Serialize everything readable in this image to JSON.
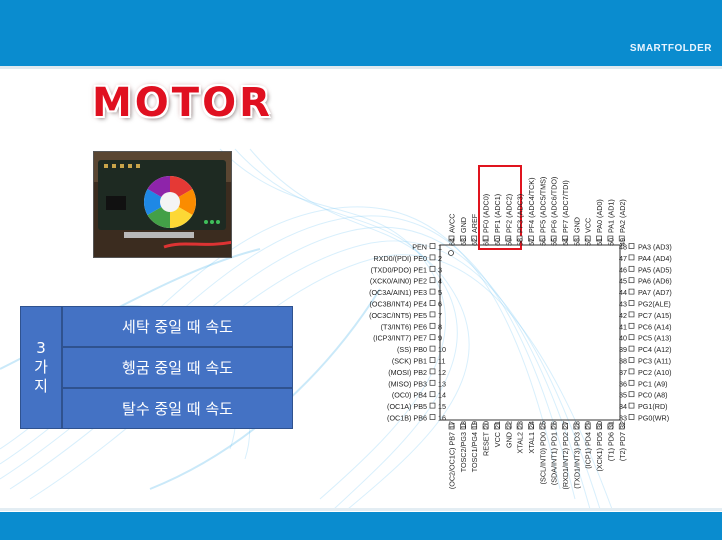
{
  "header": {
    "brand": "SMARTFOLDER"
  },
  "title": "MOTOR",
  "table": {
    "header": "3\n가\n지",
    "rows": [
      "세탁 중일 때 속도",
      "헹굼 중일 때 속도",
      "탈수 중일 때 속도"
    ]
  },
  "chip": {
    "left_pins": [
      {
        "num": "1",
        "label": "PEN"
      },
      {
        "num": "2",
        "label": "RXD0/(PDI) PE0"
      },
      {
        "num": "3",
        "label": "(TXD0/PDO) PE1"
      },
      {
        "num": "4",
        "label": "(XCK0/AIN0) PE2"
      },
      {
        "num": "5",
        "label": "(OC3A/AIN1) PE3"
      },
      {
        "num": "6",
        "label": "(OC3B/INT4) PE4"
      },
      {
        "num": "7",
        "label": "(OC3C/INT5) PE5"
      },
      {
        "num": "8",
        "label": "(T3/INT6) PE6"
      },
      {
        "num": "9",
        "label": "(ICP3/INT7) PE7"
      },
      {
        "num": "10",
        "label": "(SS) PB0"
      },
      {
        "num": "11",
        "label": "(SCK) PB1"
      },
      {
        "num": "12",
        "label": "(MOSI) PB2"
      },
      {
        "num": "13",
        "label": "(MISO) PB3"
      },
      {
        "num": "14",
        "label": "(OC0) PB4"
      },
      {
        "num": "15",
        "label": "(OC1A) PB5"
      },
      {
        "num": "16",
        "label": "(OC1B) PB6"
      }
    ],
    "right_pins": [
      {
        "num": "48",
        "label": "PA3 (AD3)"
      },
      {
        "num": "47",
        "label": "PA4 (AD4)"
      },
      {
        "num": "46",
        "label": "PA5 (AD5)"
      },
      {
        "num": "45",
        "label": "PA6 (AD6)"
      },
      {
        "num": "44",
        "label": "PA7 (AD7)"
      },
      {
        "num": "43",
        "label": "PG2(ALE)"
      },
      {
        "num": "42",
        "label": "PC7 (A15)"
      },
      {
        "num": "41",
        "label": "PC6 (A14)"
      },
      {
        "num": "40",
        "label": "PC5 (A13)"
      },
      {
        "num": "39",
        "label": "PC4 (A12)"
      },
      {
        "num": "38",
        "label": "PC3 (A11)"
      },
      {
        "num": "37",
        "label": "PC2 (A10)"
      },
      {
        "num": "36",
        "label": "PC1 (A9)"
      },
      {
        "num": "35",
        "label": "PC0 (A8)"
      },
      {
        "num": "34",
        "label": "PG1(RD)"
      },
      {
        "num": "33",
        "label": "PG0(WR)"
      }
    ],
    "top_pins": [
      {
        "num": "64",
        "label": "AVCC"
      },
      {
        "num": "63",
        "label": "GND"
      },
      {
        "num": "62",
        "label": "AREF"
      },
      {
        "num": "61",
        "label": "PF0 (ADC0)"
      },
      {
        "num": "60",
        "label": "PF1 (ADC1)"
      },
      {
        "num": "59",
        "label": "PF2 (ADC2)"
      },
      {
        "num": "58",
        "label": "PF3 (ADC3)"
      },
      {
        "num": "57",
        "label": "PF4 (ADC4/TCK)"
      },
      {
        "num": "56",
        "label": "PF5 (ADC5/TMS)"
      },
      {
        "num": "55",
        "label": "PF6 (ADC6/TDO)"
      },
      {
        "num": "54",
        "label": "PF7 (ADC7/TDI)"
      },
      {
        "num": "53",
        "label": "GND"
      },
      {
        "num": "52",
        "label": "VCC"
      },
      {
        "num": "51",
        "label": "PA0 (AD0)"
      },
      {
        "num": "50",
        "label": "PA1 (AD1)"
      },
      {
        "num": "49",
        "label": "PA2 (AD2)"
      }
    ],
    "bottom_pins": [
      {
        "num": "17",
        "label": "(OC2/OC1C) PB7"
      },
      {
        "num": "18",
        "label": "TOSC2/PG3"
      },
      {
        "num": "19",
        "label": "TOSC1/PG4"
      },
      {
        "num": "20",
        "label": "RESET"
      },
      {
        "num": "21",
        "label": "VCC"
      },
      {
        "num": "22",
        "label": "GND"
      },
      {
        "num": "23",
        "label": "XTAL2"
      },
      {
        "num": "24",
        "label": "XTAL1"
      },
      {
        "num": "25",
        "label": "(SCL/INT0) PD0"
      },
      {
        "num": "26",
        "label": "(SDA/INT1) PD1"
      },
      {
        "num": "27",
        "label": "(RXD1/INT2) PD2"
      },
      {
        "num": "28",
        "label": "(TXD1/INT3) PD3"
      },
      {
        "num": "29",
        "label": "(ICP1) PD4"
      },
      {
        "num": "30",
        "label": "(XCK1) PD5"
      },
      {
        "num": "31",
        "label": "(T1) PD6"
      },
      {
        "num": "32",
        "label": "(T2) PD7"
      }
    ],
    "highlight_color": "#e0141e"
  },
  "colors": {
    "brand_blue": "#0a8ccf",
    "cell_blue": "#4472c4",
    "title_red": "#e01020"
  }
}
